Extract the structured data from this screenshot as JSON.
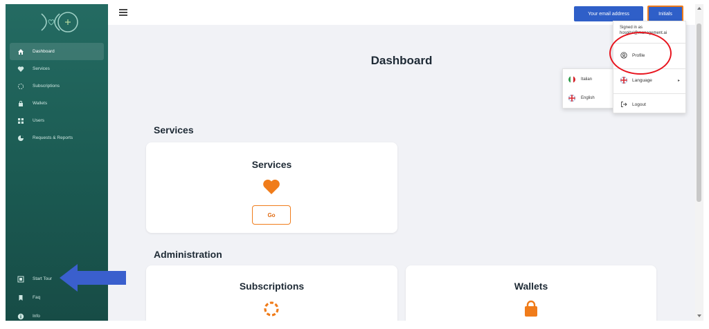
{
  "sidebar": {
    "items": [
      {
        "label": "Dashboard",
        "icon": "home-icon",
        "active": true
      },
      {
        "label": "Services",
        "icon": "heart-icon"
      },
      {
        "label": "Subscriptions",
        "icon": "subscriptions-icon"
      },
      {
        "label": "Wallets",
        "icon": "wallet-icon"
      },
      {
        "label": "Users",
        "icon": "users-icon"
      },
      {
        "label": "Requests & Reports",
        "icon": "reports-icon"
      }
    ],
    "bottom_items": [
      {
        "label": "Start Tour",
        "icon": "tour-icon"
      },
      {
        "label": "Faq",
        "icon": "bookmark-icon"
      },
      {
        "label": "Info",
        "icon": "info-icon"
      }
    ]
  },
  "topbar": {
    "email_label": "Your email address",
    "initials_label": "Initials"
  },
  "page": {
    "title": "Dashboard"
  },
  "sections": {
    "services": {
      "title": "Services",
      "card_title": "Services",
      "go_label": "Go"
    },
    "administration": {
      "title": "Administration",
      "cards": [
        {
          "title": "Subscriptions"
        },
        {
          "title": "Wallets"
        }
      ]
    }
  },
  "user_menu": {
    "signed_in_label": "Signed in as",
    "signed_in_user": "hospital@management.ai",
    "profile_label": "Profile",
    "language_label": "Language",
    "logout_label": "Logout"
  },
  "language_menu": {
    "options": [
      "Italian",
      "English"
    ]
  },
  "colors": {
    "accent_orange": "#f07c1a",
    "primary_blue": "#2f5fc8",
    "sidebar_green": "#1b5a52",
    "annotation_red": "#e8141e",
    "annotation_blue": "#3a5fcd"
  }
}
